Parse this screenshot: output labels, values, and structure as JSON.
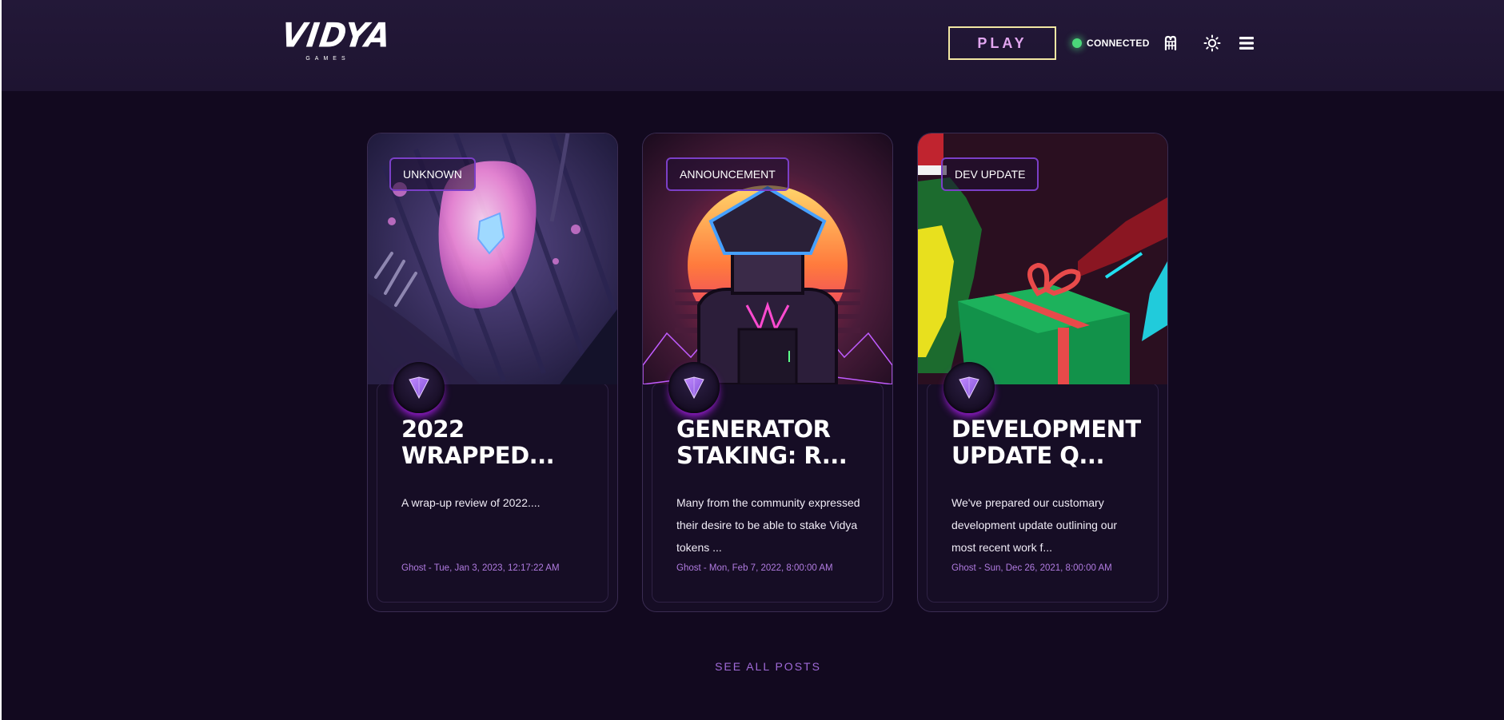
{
  "header": {
    "logo_text": "VIDYA",
    "logo_sub": "GAMES",
    "play_label": "PLAY",
    "connection_status": "CONNECTED",
    "icons": [
      "bridge-icon",
      "sun-icon",
      "menu-icon"
    ]
  },
  "posts": [
    {
      "tag": "UNKNOWN",
      "title": "2022 WRAPPED...",
      "description": "A wrap-up review of 2022....",
      "meta": "Ghost - Tue, Jan 3, 2023, 12:17:22 AM"
    },
    {
      "tag": "ANNOUNCEMENT",
      "title": "GENERATOR STAKING: R...",
      "description": "Many from the community expressed their desire to be able to stake Vidya tokens ...",
      "meta": "Ghost - Mon, Feb 7, 2022, 8:00:00 AM"
    },
    {
      "tag": "DEV UPDATE",
      "title": "DEVELOPMENT UPDATE Q...",
      "description": "We've prepared our customary development update outlining our most recent work f...",
      "meta": "Ghost - Sun, Dec 26, 2021, 8:00:00 AM"
    }
  ],
  "see_all_label": "SEE ALL POSTS",
  "colors": {
    "background": "#12091f",
    "header": "#231838",
    "accent_purple": "#7b3fc7",
    "play_border": "#f2e7a3",
    "connected_green": "#4bd87a",
    "meta_text": "#b07be0"
  }
}
